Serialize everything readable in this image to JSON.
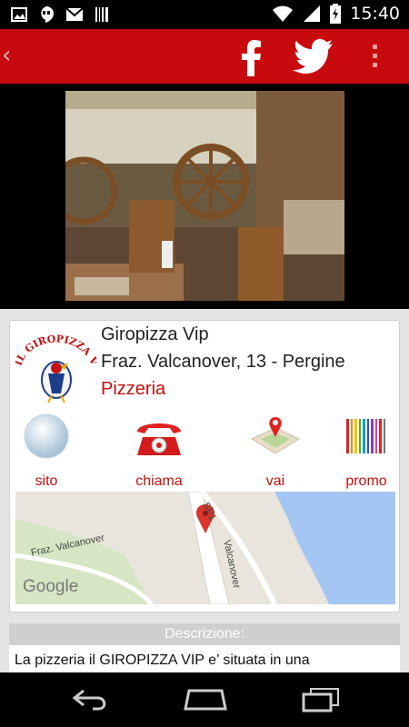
{
  "status_bar": {
    "time": "15:40",
    "left_icons": [
      "image-icon",
      "hangouts-icon",
      "gmail-icon",
      "barcode-icon"
    ],
    "right_icons": [
      "wifi-icon",
      "signal-icon",
      "battery-icon"
    ]
  },
  "action_bar": {
    "back_glyph": "‹",
    "facebook_icon": "facebook-icon",
    "twitter_icon": "twitter-icon",
    "overflow_icon": "overflow-menu-icon",
    "accent": "#c8090d"
  },
  "business": {
    "logo_text": "IL GIROPIZZA VIP",
    "name": "Giropizza Vip",
    "address": "Fraz. Valcanover, 13 - Pergine",
    "category": "Pizzeria"
  },
  "actions": [
    {
      "label": "sito",
      "icon": "globe-icon"
    },
    {
      "label": "chiama",
      "icon": "telephone-icon"
    },
    {
      "label": "vai",
      "icon": "map-pin-icon"
    },
    {
      "label": "promo",
      "icon": "barcode-promo-icon"
    }
  ],
  "map": {
    "labels": [
      "SP1",
      "Valcanover",
      "Fraz. Valcanover"
    ],
    "attribution": "Google"
  },
  "description": {
    "header": "Descrizione:",
    "text": "La pizzeria il GIROPIZZA VIP e’ situata in una"
  },
  "nav_bar": {
    "icons": [
      "back-nav-icon",
      "home-nav-icon",
      "recents-nav-icon"
    ]
  }
}
